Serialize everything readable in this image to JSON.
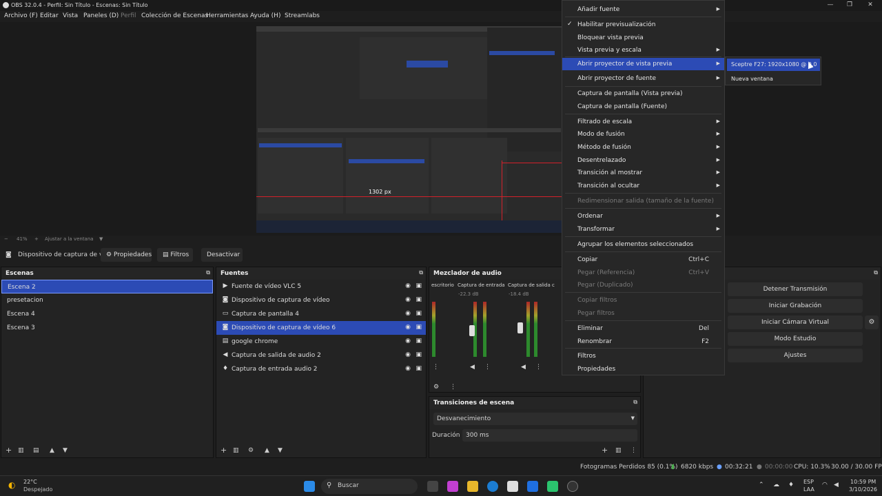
{
  "window": {
    "title": "OBS 32.0.4 - Perfil: Sin Título - Escenas: Sin Título",
    "controls": [
      "—",
      "❐",
      "✕"
    ]
  },
  "menubar": [
    "Archivo (F)",
    "Editar",
    "Vista",
    "Paneles (D)",
    "Perfil",
    "Colección de Escenas",
    "Herramientas",
    "Ayuda (H)",
    "Streamlabs"
  ],
  "preview": {
    "zoom": "41%",
    "fit_label": "Ajustar a la ventana",
    "measure_label": "1302 px"
  },
  "toolbar": {
    "selected_source": "Dispositivo de captura de v",
    "properties_label": "Propiedades",
    "filters_label": "Filtros",
    "deactivate_label": "Desactivar"
  },
  "scenes": {
    "title": "Escenas",
    "items": [
      "Escena 2",
      "presetacion",
      "Escena 4",
      "Escena 3"
    ],
    "selected": 0
  },
  "sources": {
    "title": "Fuentes",
    "items": [
      {
        "label": "Fuente de vídeo VLC 5",
        "icon": "play-icon",
        "glyph": "▶"
      },
      {
        "label": "Dispositivo de captura de vídeo",
        "icon": "camera-icon",
        "glyph": "◙"
      },
      {
        "label": "Captura de pantalla 4",
        "icon": "monitor-icon",
        "glyph": "▭"
      },
      {
        "label": "Dispositivo de captura de vídeo 6",
        "icon": "camera-icon",
        "glyph": "◙"
      },
      {
        "label": "google chrome",
        "icon": "window-icon",
        "glyph": "▤"
      },
      {
        "label": "Captura de salida de audio 2",
        "icon": "speaker-icon",
        "glyph": "◀"
      },
      {
        "label": "Captura de entrada audio 2",
        "icon": "mic-icon",
        "glyph": "♦"
      }
    ],
    "selected": 3
  },
  "mixer": {
    "title": "Mezclador de audio",
    "channels": [
      {
        "name": "escritorio",
        "db": ""
      },
      {
        "name": "Captura de entrada",
        "db": "-22.3 dB",
        "level": 0.45
      },
      {
        "name": "Captura de salida c",
        "db": "-18.4 dB",
        "level": 0.7
      }
    ],
    "scale": [
      "0",
      "-5",
      "-10",
      "-15",
      "-20",
      "-25",
      "-30",
      "-35",
      "-40",
      "-45",
      "-50",
      "-55",
      "-60"
    ]
  },
  "transitions": {
    "title": "Transiciones de escena",
    "selected": "Desvanecimiento",
    "duration_label": "Duración",
    "duration_value": "300 ms"
  },
  "controls": {
    "buttons": [
      "Detener Transmisión",
      "Iniciar Grabación",
      "Iniciar Cámara Virtual",
      "Modo Estudio",
      "Ajustes"
    ]
  },
  "status": {
    "dropped_frames": "Fotogramas Perdidos 85 (0.1%)",
    "bitrate": "6820 kbps",
    "stream_time": "00:32:21",
    "rec_time": "00:00:00",
    "cpu": "CPU: 10.3%",
    "fps": "30.00 / 30.00 FPS"
  },
  "context_menu": {
    "items": [
      {
        "label": "Añadir fuente",
        "submenu": true
      },
      {
        "label": "Habilitar previsualización",
        "checked": true
      },
      {
        "label": "Bloquear vista previa"
      },
      {
        "label": "Vista previa y escala",
        "submenu": true
      },
      {
        "label": "Abrir proyector de vista previa",
        "submenu": true,
        "highlighted": true
      },
      {
        "label": "Abrir proyector de fuente",
        "submenu": true
      },
      {
        "label": "Captura de pantalla (Vista previa)"
      },
      {
        "label": "Captura de pantalla (Fuente)"
      },
      {
        "label": "Filtrado de escala",
        "submenu": true
      },
      {
        "label": "Modo de fusión",
        "submenu": true
      },
      {
        "label": "Método de fusión",
        "submenu": true
      },
      {
        "label": "Desentrelazado",
        "submenu": true
      },
      {
        "label": "Transición al mostrar",
        "submenu": true
      },
      {
        "label": "Transición al ocultar",
        "submenu": true
      },
      {
        "label": "Redimensionar salida (tamaño de la fuente)",
        "disabled": true
      },
      {
        "label": "Ordenar",
        "submenu": true
      },
      {
        "label": "Transformar",
        "submenu": true
      },
      {
        "label": "Agrupar los elementos seleccionados"
      },
      {
        "label": "Copiar",
        "shortcut": "Ctrl+C"
      },
      {
        "label": "Pegar (Referencia)",
        "shortcut": "Ctrl+V",
        "disabled": true
      },
      {
        "label": "Pegar (Duplicado)",
        "disabled": true
      },
      {
        "label": "Copiar filtros",
        "disabled": true
      },
      {
        "label": "Pegar filtros",
        "disabled": true
      },
      {
        "label": "Eliminar",
        "shortcut": "Del"
      },
      {
        "label": "Renombrar",
        "shortcut": "F2"
      },
      {
        "label": "Filtros"
      },
      {
        "label": "Propiedades"
      }
    ]
  },
  "submenu": {
    "items": [
      "Sceptre F27: 1920x1080 @ 0,0",
      "Nueva ventana"
    ],
    "highlighted": 0
  },
  "taskbar": {
    "weather_temp": "22°C",
    "weather_desc": "Despejado",
    "search_placeholder": "Buscar",
    "lang_primary": "ESP",
    "lang_secondary": "LAA",
    "time": "10:59 PM",
    "date": "3/10/2026"
  }
}
